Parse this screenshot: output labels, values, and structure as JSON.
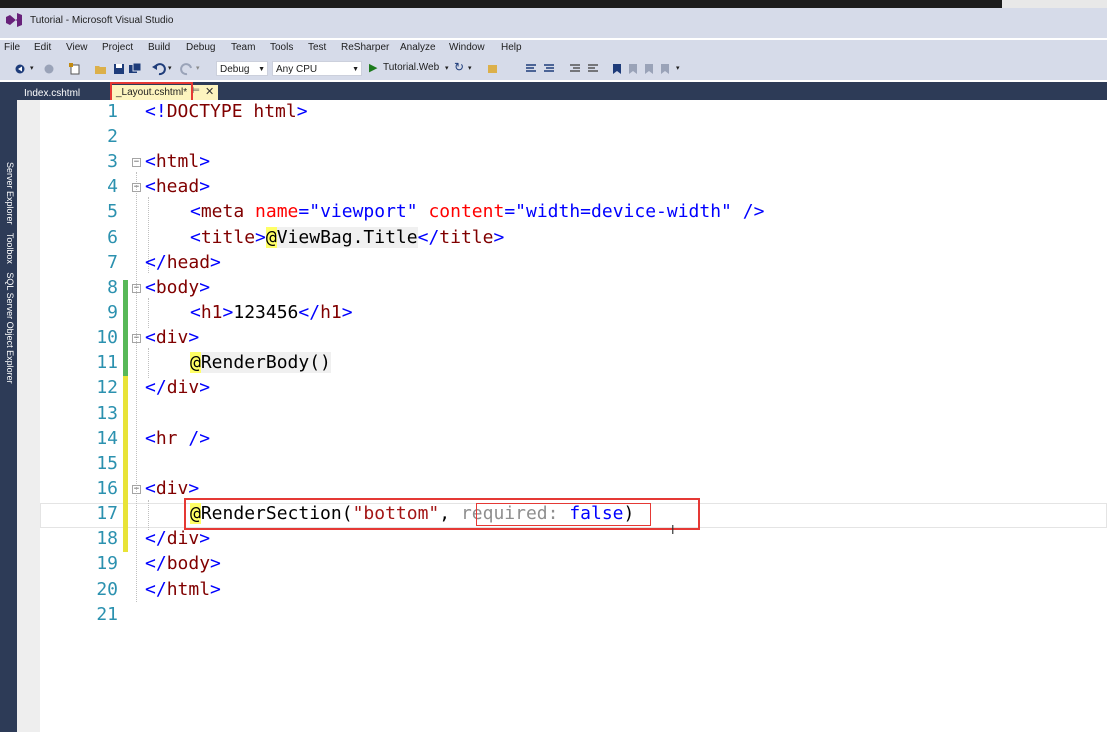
{
  "window": {
    "title": "Tutorial - Microsoft Visual Studio"
  },
  "menu": [
    "File",
    "Edit",
    "View",
    "Project",
    "Build",
    "Debug",
    "Team",
    "Tools",
    "Test",
    "ReSharper",
    "Analyze",
    "Window",
    "Help"
  ],
  "toolbar": {
    "config": "Debug",
    "platform": "Any CPU",
    "run_target": "Tutorial.Web"
  },
  "sidebar": {
    "items": [
      "Server Explorer",
      "Toolbox",
      "SQL Server Object Explorer"
    ]
  },
  "tabs": [
    {
      "label": "Index.cshtml",
      "active": false
    },
    {
      "label": "_Layout.cshtml*",
      "active": true
    }
  ],
  "editor": {
    "line_numbers": [
      "1",
      "2",
      "3",
      "4",
      "5",
      "6",
      "7",
      "8",
      "9",
      "10",
      "11",
      "12",
      "13",
      "14",
      "15",
      "16",
      "17",
      "18",
      "19",
      "20",
      "21"
    ],
    "l1": {
      "a": "<!",
      "b": "DOCTYPE",
      "c": " html",
      "d": ">"
    },
    "l3": {
      "a": "<",
      "b": "html",
      "c": ">"
    },
    "l4": {
      "a": "<",
      "b": "head",
      "c": ">"
    },
    "l5": {
      "a": "<",
      "b": "meta",
      "c": " name",
      "d": "=",
      "e": "\"viewport\"",
      "f": " content",
      "g": "=",
      "h": "\"width=device-width\"",
      "i": " />"
    },
    "l6": {
      "a": "<",
      "b": "title",
      "c": ">",
      "d": "@",
      "e": "ViewBag.Title",
      "f": "</",
      "g": "title",
      "h": ">"
    },
    "l7": {
      "a": "</",
      "b": "head",
      "c": ">"
    },
    "l8": {
      "a": "<",
      "b": "body",
      "c": ">"
    },
    "l9": {
      "a": "<",
      "b": "h1",
      "c": ">",
      "d": "123456",
      "e": "</",
      "f": "h1",
      "g": ">"
    },
    "l10": {
      "a": "<",
      "b": "div",
      "c": ">"
    },
    "l11": {
      "a": "@",
      "b": "RenderBody()"
    },
    "l12": {
      "a": "</",
      "b": "div",
      "c": ">"
    },
    "l14": {
      "a": "<",
      "b": "hr",
      "c": " />"
    },
    "l16": {
      "a": "<",
      "b": "div",
      "c": ">"
    },
    "l17": {
      "a": "@",
      "b": "RenderSection(",
      "c": "\"bottom\"",
      "d": ", ",
      "e": "required: ",
      "f": "false",
      "g": ")"
    },
    "l18": {
      "a": "</",
      "b": "div",
      "c": ">"
    },
    "l19": {
      "a": "</",
      "b": "body",
      "c": ">"
    },
    "l20": {
      "a": "</",
      "b": "html",
      "c": ">"
    }
  },
  "colors": {
    "tag": "#800000",
    "attr": "#ff0000",
    "value": "#0000ff",
    "string": "#a31515",
    "highlight_box": "#e53935",
    "razor_bg": "#ffff66"
  }
}
